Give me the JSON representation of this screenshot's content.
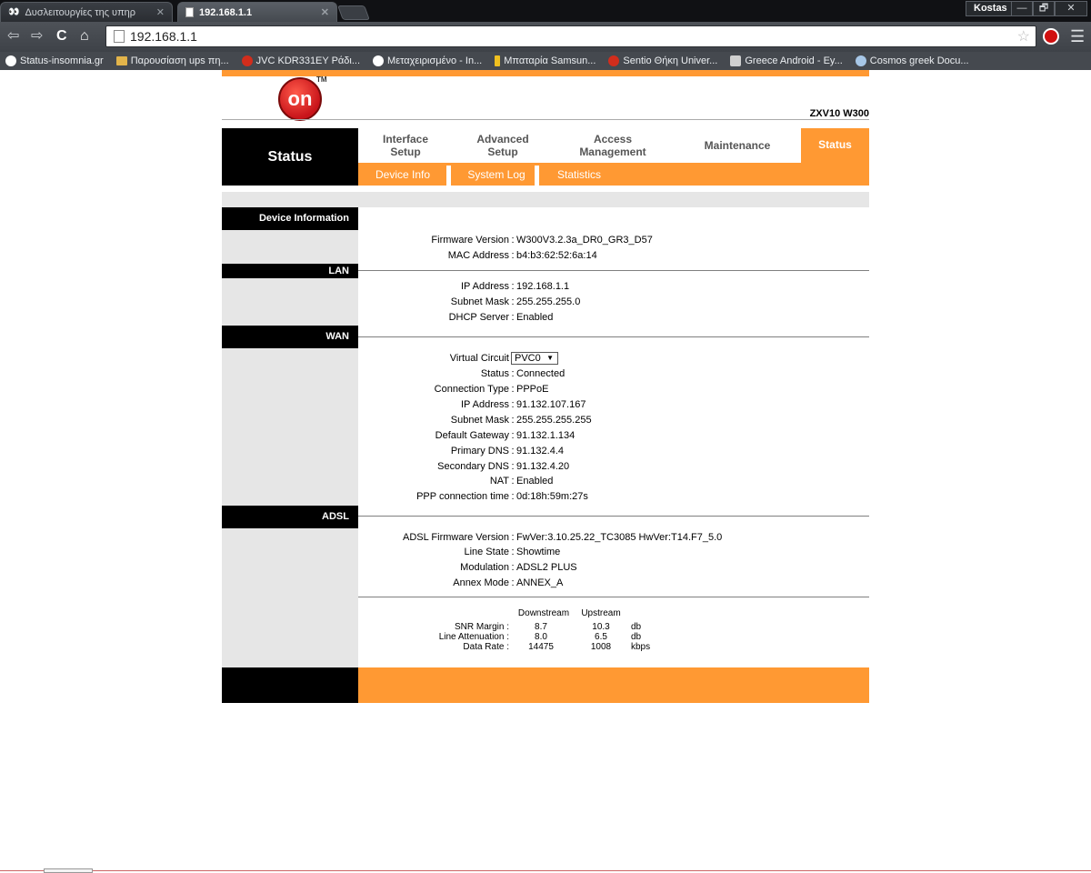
{
  "browser": {
    "tabs": [
      {
        "title": "Δυσλειτουργίες της υπηρ",
        "active": false
      },
      {
        "title": "192.168.1.1",
        "active": true
      }
    ],
    "user": "Kostas",
    "window_buttons": [
      "—",
      "🗗",
      "✕"
    ],
    "address": "192.168.1.1",
    "bookmarks": [
      {
        "label": "Status-insomnia.gr",
        "icon": "eyes-icon"
      },
      {
        "label": "Παρουσίαση ups πη...",
        "icon": "folder-icon"
      },
      {
        "label": "JVC KDR331EY Ράδι...",
        "icon": "red-circle-icon"
      },
      {
        "label": "Μεταχειρισμένο - In...",
        "icon": "eyes-icon"
      },
      {
        "label": "Μπαταρία Samsun...",
        "icon": "battery-icon"
      },
      {
        "label": "Sentio Θήκη Univer...",
        "icon": "red-circle-icon"
      },
      {
        "label": "Greece Android - Εy...",
        "icon": "android-icon"
      },
      {
        "label": "Cosmos greek Docu...",
        "icon": "globe-icon"
      }
    ]
  },
  "router": {
    "logo_text": "on",
    "logo_tm": "TM",
    "model": "ZXV10 W300",
    "page_header": "Status",
    "nav": [
      {
        "label_1": "Interface",
        "label_2": "Setup"
      },
      {
        "label_1": "Advanced",
        "label_2": "Setup"
      },
      {
        "label_1": "Access",
        "label_2": "Management"
      },
      {
        "label_1": "Maintenance",
        "label_2": ""
      },
      {
        "label_1": "Status",
        "label_2": ""
      }
    ],
    "subnav": [
      "Device Info",
      "System Log",
      "Statistics"
    ],
    "sections": {
      "device": {
        "title": "Device Information",
        "rows": [
          {
            "label": "Firmware Version",
            "value": "W300V3.2.3a_DR0_GR3_D57"
          },
          {
            "label": "MAC Address",
            "value": "b4:b3:62:52:6a:14"
          }
        ]
      },
      "lan": {
        "title": "LAN",
        "rows": [
          {
            "label": "IP Address",
            "value": "192.168.1.1"
          },
          {
            "label": "Subnet Mask",
            "value": "255.255.255.0"
          },
          {
            "label": "DHCP Server",
            "value": "Enabled"
          }
        ]
      },
      "wan": {
        "title": "WAN",
        "virtual_circuit_label": "Virtual Circuit",
        "virtual_circuit_value": "PVC0",
        "rows": [
          {
            "label": "Status",
            "value": "Connected"
          },
          {
            "label": "Connection Type",
            "value": "PPPoE"
          },
          {
            "label": "IP Address",
            "value": "91.132.107.167"
          },
          {
            "label": "Subnet Mask",
            "value": "255.255.255.255"
          },
          {
            "label": "Default Gateway",
            "value": "91.132.1.134"
          },
          {
            "label": "Primary DNS",
            "value": "91.132.4.4"
          },
          {
            "label": "Secondary DNS",
            "value": "91.132.4.20"
          },
          {
            "label": "NAT",
            "value": "Enabled"
          },
          {
            "label": "PPP connection time",
            "value": "0d:18h:59m:27s"
          }
        ]
      },
      "adsl": {
        "title": "ADSL",
        "rows": [
          {
            "label": "ADSL Firmware Version",
            "value": "FwVer:3.10.25.22_TC3085 HwVer:T14.F7_5.0"
          },
          {
            "label": "Line State",
            "value": "Showtime"
          },
          {
            "label": "Modulation",
            "value": "ADSL2 PLUS"
          },
          {
            "label": "Annex Mode",
            "value": "ANNEX_A"
          }
        ],
        "stats": {
          "col_down": "Downstream",
          "col_up": "Upstream",
          "rows": [
            {
              "label": "SNR Margin :",
              "down": "8.7",
              "up": "10.3",
              "unit": "db"
            },
            {
              "label": "Line Attenuation :",
              "down": "8.0",
              "up": "6.5",
              "unit": "db"
            },
            {
              "label": "Data Rate :",
              "down": "14475",
              "up": "1008",
              "unit": "kbps"
            }
          ]
        }
      }
    }
  }
}
